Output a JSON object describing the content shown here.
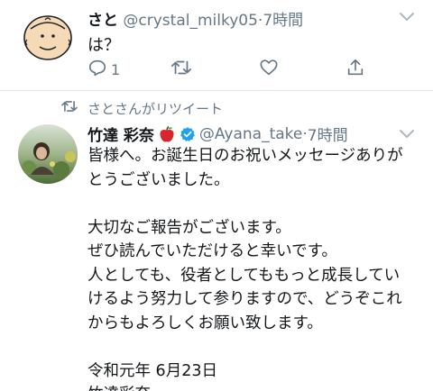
{
  "tweet1": {
    "name": "さと",
    "handle": "@crystal_milky05",
    "time": "7時間",
    "text": "は？",
    "reply_count": "1",
    "retweet_count": "",
    "like_count": ""
  },
  "retweet_banner": {
    "text": "さとさんがリツイート"
  },
  "tweet2": {
    "name": "竹達 彩奈",
    "handle": "@Ayana_take",
    "time": "7時間",
    "lines": [
      "皆様へ。お誕生日のお祝いメッセージありが",
      "とうございました。",
      "",
      "大切なご報告がございます。",
      "ぜひ読んでいただけると幸いです。",
      "人としても、役者としてももっと成長してい",
      "けるよう努力して参りますので、どうぞこれ",
      "からもよろしくお願い致します。",
      "",
      "令和元年 6月23日",
      "竹達彩奈"
    ]
  },
  "colors": {
    "text": "#14171a",
    "secondary": "#657786",
    "verified": "#1da1f2",
    "divider": "#e1e8ed"
  },
  "icons": [
    "reply-icon",
    "retweet-icon",
    "like-icon",
    "share-icon",
    "chevron-down-icon",
    "verified-icon",
    "apple-emoji"
  ]
}
